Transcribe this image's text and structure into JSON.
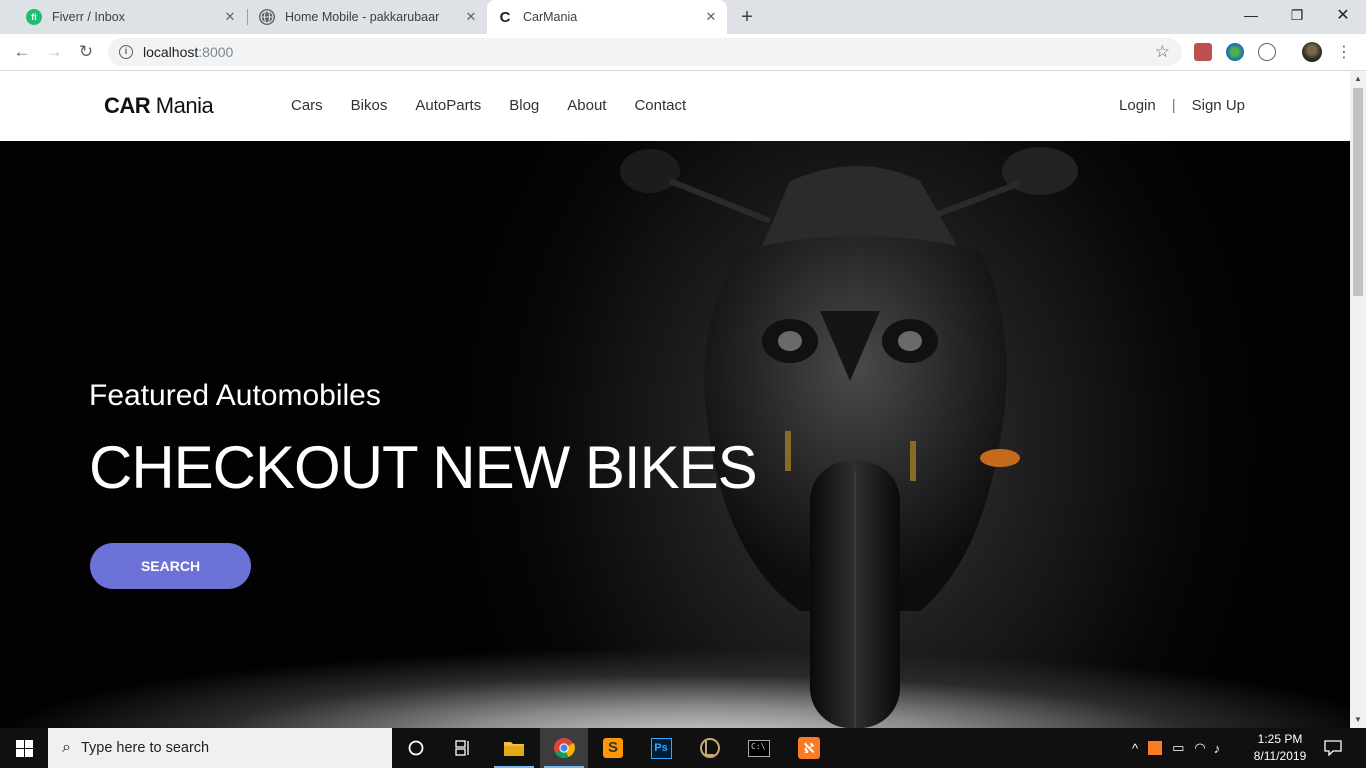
{
  "browser": {
    "tabs": [
      {
        "title": "Fiverr / Inbox",
        "favicon": "fiverr-icon",
        "favicon_text": "fi",
        "active": false
      },
      {
        "title": "Home Mobile - pakkarubaar",
        "favicon": "globe-icon",
        "active": false
      },
      {
        "title": "CarMania",
        "favicon": "carmania-icon",
        "active": true
      }
    ],
    "url_host": "localhost",
    "url_port": ":8000"
  },
  "site": {
    "logo_bold": "CAR",
    "logo_rest": " Mania",
    "nav": [
      "Cars",
      "Bikos",
      "AutoParts",
      "Blog",
      "About",
      "Contact"
    ],
    "login": "Login",
    "auth_separator": "|",
    "signup": "Sign Up"
  },
  "hero": {
    "subtitle": "Featured Automobiles",
    "title": "CHECKOUT NEW BIKES",
    "button": "SEARCH",
    "button_color": "#6c72d6"
  },
  "taskbar": {
    "search_placeholder": "Type here to search",
    "time": "1:25 PM",
    "date": "8/11/2019"
  }
}
